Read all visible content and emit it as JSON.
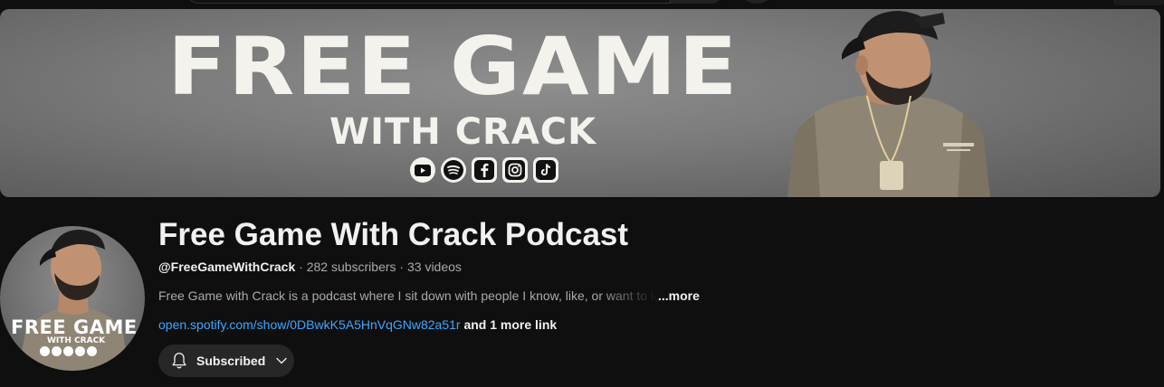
{
  "banner": {
    "title": "FREE GAME",
    "subtitle": "WITH CRACK",
    "social_icons": [
      "youtube-icon",
      "spotify-icon",
      "facebook-icon",
      "instagram-icon",
      "tiktok-icon"
    ]
  },
  "avatar": {
    "title": "FREE GAME",
    "subtitle": "WITH CRACK"
  },
  "channel": {
    "name": "Free Game With Crack Podcast",
    "handle": "@FreeGameWithCrack",
    "sep1": " · ",
    "subscribers": "282 subscribers",
    "sep2": " · ",
    "videos": "33 videos",
    "description": "Free Game with Crack is a podcast where I sit down with people I know, like, or want to learn from",
    "more_label": "...more",
    "link": "open.spotify.com/show/0DBwkK5A5HnVqGNw82a51r",
    "more_links": " and 1 more link"
  },
  "subscribe": {
    "label": "Subscribed"
  },
  "colors": {
    "background": "#0f0f0f",
    "link": "#3ea6ff",
    "button_bg": "#272727",
    "muted_text": "#aaaaaa"
  }
}
